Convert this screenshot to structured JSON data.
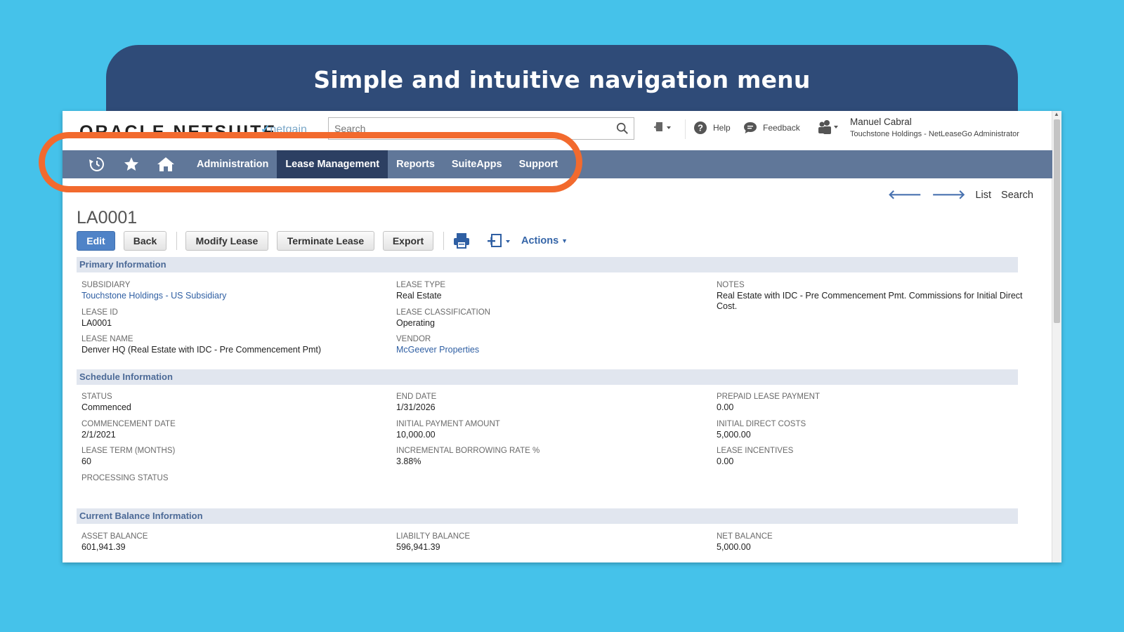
{
  "banner": {
    "title": "Simple and intuitive navigation menu"
  },
  "header": {
    "logo": "ORACLE NETSUITE",
    "partner": "netgain",
    "search_placeholder": "Search",
    "help": "Help",
    "feedback": "Feedback",
    "user_name": "Manuel Cabral",
    "user_role": "Touchstone Holdings - NetLeaseGo Administrator"
  },
  "nav": {
    "items": [
      {
        "label": "Administration",
        "active": false
      },
      {
        "label": "Lease Management",
        "active": true
      },
      {
        "label": "Reports",
        "active": false
      },
      {
        "label": "SuiteApps",
        "active": false
      },
      {
        "label": "Support",
        "active": false
      }
    ]
  },
  "record": {
    "list": "List",
    "search": "Search",
    "title": "LA0001",
    "buttons": {
      "edit": "Edit",
      "back": "Back",
      "modify": "Modify Lease",
      "terminate": "Terminate Lease",
      "export": "Export",
      "actions": "Actions"
    }
  },
  "sections": {
    "primary": {
      "title": "Primary Information",
      "fields": [
        {
          "label": "SUBSIDIARY",
          "value": "Touchstone Holdings - US Subsidiary"
        },
        {
          "label": "LEASE ID",
          "value": "LA0001"
        },
        {
          "label": "LEASE NAME",
          "value": "Denver HQ (Real Estate with IDC - Pre Commencement Pmt)"
        },
        {
          "label": "LEASE TYPE",
          "value": "Real Estate"
        },
        {
          "label": "LEASE CLASSIFICATION",
          "value": "Operating"
        },
        {
          "label": "VENDOR",
          "value": "McGeever Properties"
        },
        {
          "label": "NOTES",
          "value": "Real Estate with IDC - Pre Commencement Pmt. Commissions for Initial Direct Cost."
        }
      ]
    },
    "schedule": {
      "title": "Schedule Information",
      "fields": [
        {
          "label": "STATUS",
          "value": "Commenced"
        },
        {
          "label": "COMMENCEMENT DATE",
          "value": "2/1/2021"
        },
        {
          "label": "LEASE TERM (MONTHS)",
          "value": "60"
        },
        {
          "label": "PROCESSING STATUS",
          "value": ""
        },
        {
          "label": "END DATE",
          "value": "1/31/2026"
        },
        {
          "label": "INITIAL PAYMENT AMOUNT",
          "value": "10,000.00"
        },
        {
          "label": "INCREMENTAL BORROWING RATE %",
          "value": "3.88%"
        },
        {
          "label": "PREPAID LEASE PAYMENT",
          "value": "0.00"
        },
        {
          "label": "INITIAL DIRECT COSTS",
          "value": "5,000.00"
        },
        {
          "label": "LEASE INCENTIVES",
          "value": "0.00"
        }
      ]
    },
    "balance": {
      "title": "Current Balance Information",
      "fields": [
        {
          "label": "ASSET BALANCE",
          "value": "601,941.39"
        },
        {
          "label": "LIABILTY BALANCE",
          "value": "596,941.39"
        },
        {
          "label": "NET BALANCE",
          "value": "5,000.00"
        }
      ]
    }
  },
  "colors": {
    "background": "#45c2ea",
    "banner": "#2f4b78",
    "nav": "#607799",
    "nav_active": "#2c3f62",
    "highlight": "#f26a2e",
    "link": "#2f5fa3",
    "primary_button": "#4f83c7"
  }
}
